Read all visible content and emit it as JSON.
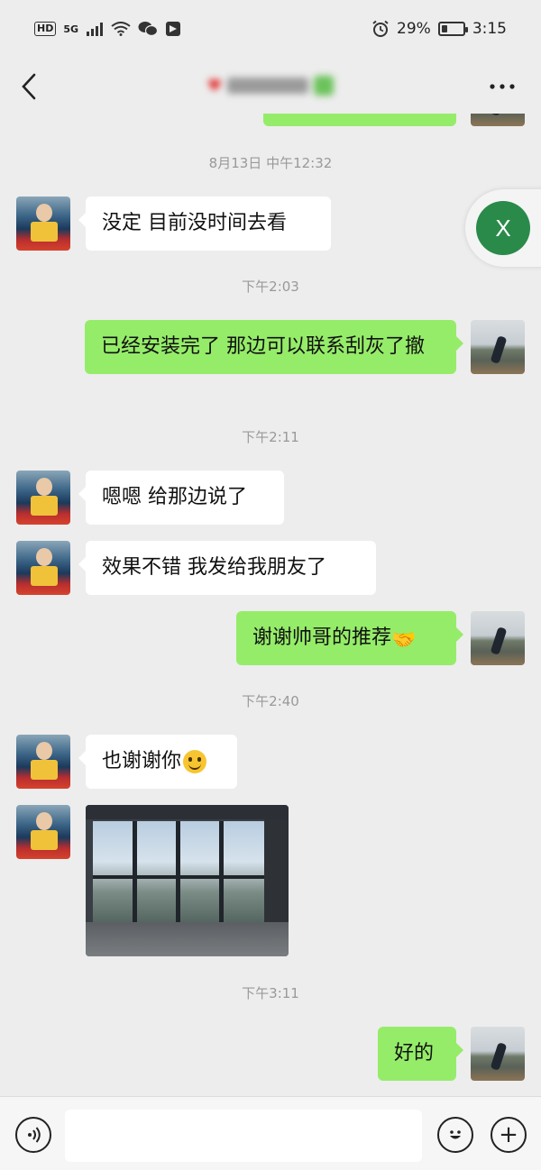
{
  "status_bar": {
    "hd": "HD",
    "network": "5G",
    "battery": "29%",
    "battery_level": 0.29,
    "time": "3:15"
  },
  "nav": {
    "title": "♥"
  },
  "messages": {
    "ts1": "8月13日 中午12:32",
    "m1": "没定 目前没时间去看",
    "ts2": "下午2:03",
    "m2": "已经安装完了 那边可以联系刮灰了撤",
    "ts3": "下午2:11",
    "m3": "嗯嗯 给那边说了",
    "m4": "效果不错 我发给我朋友了",
    "m5": "谢谢帅哥的推荐",
    "m5_emoji": "🤝",
    "ts4": "下午2:40",
    "m6": "也谢谢你",
    "ts5": "下午3:11",
    "m7": "好的"
  },
  "close_button": {
    "label": "X"
  },
  "input_bar": {
    "placeholder": "",
    "plus": "+"
  },
  "colors": {
    "background": "#ededed",
    "my_bubble": "#95ec69",
    "their_bubble": "#ffffff",
    "accent": "#2a8a4a"
  }
}
